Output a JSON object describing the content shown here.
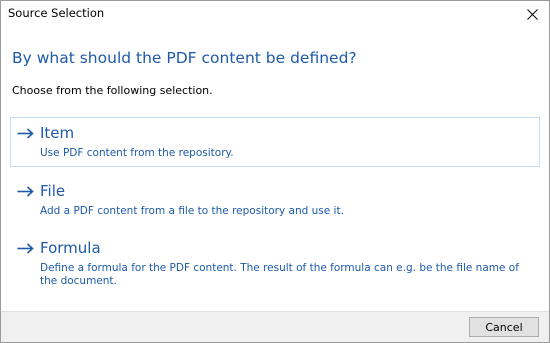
{
  "window": {
    "title": "Source Selection",
    "close_icon": "close-icon"
  },
  "dialog": {
    "heading": "By what should the PDF content be defined?",
    "instruction": "Choose from the following selection."
  },
  "options": [
    {
      "title": "Item",
      "description": "Use PDF content from the repository.",
      "icon": "arrow-right-icon",
      "selected": true
    },
    {
      "title": "File",
      "description": "Add a PDF content from a file to the repository and use it.",
      "icon": "arrow-right-icon",
      "selected": false
    },
    {
      "title": "Formula",
      "description": "Define a formula for the PDF content. The result of the formula can e.g. be the file name of the document.",
      "icon": "arrow-right-icon",
      "selected": false
    }
  ],
  "footer": {
    "cancel_label": "Cancel"
  },
  "colors": {
    "accent": "#1e5aa8",
    "selection_border": "#c6dcf2",
    "footer_bg": "#f0f0f0"
  }
}
